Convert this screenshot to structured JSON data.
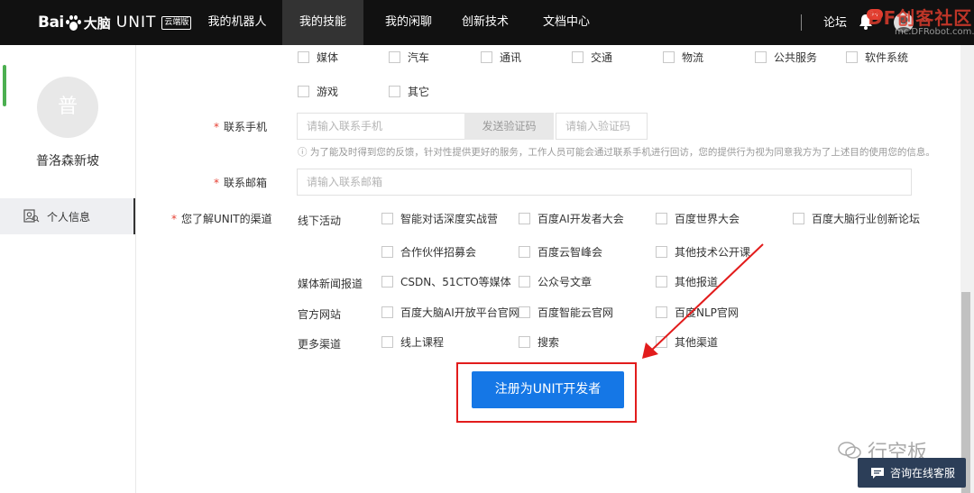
{
  "nav": {
    "logo_bai": "Bai",
    "logo_du": "大脑",
    "logo_unit": "UNIT",
    "logo_edition": "云端版",
    "items": [
      {
        "label": "我的机器人",
        "active": false
      },
      {
        "label": "我的技能",
        "active": true
      },
      {
        "label": "我的闲聊",
        "active": false
      },
      {
        "label": "创新技术",
        "active": false
      },
      {
        "label": "文档中心",
        "active": false
      }
    ],
    "forum": "论坛",
    "notification_badge": "9+"
  },
  "watermark_top": {
    "text": "DF创客社区",
    "sub": "mc.DFRobot.com.cn"
  },
  "sidebar": {
    "avatar_text": "普",
    "username": "普洛森新坡",
    "menu_item": "个人信息"
  },
  "industry_options_row1": [
    "媒体",
    "汽车",
    "通讯",
    "交通",
    "物流",
    "公共服务",
    "软件系统"
  ],
  "industry_options_row2": [
    "游戏",
    "其它"
  ],
  "phone": {
    "label": "联系手机",
    "placeholder": "请输入联系手机",
    "send_code": "发送验证码",
    "code_placeholder": "请输入验证码",
    "hint": "ⓘ 为了能及时得到您的反馈，针对性提供更好的服务，工作人员可能会通过联系手机进行回访，您的提供行为视为同意我方为了上述目的使用您的信息。"
  },
  "email": {
    "label": "联系邮箱",
    "placeholder": "请输入联系邮箱"
  },
  "channel": {
    "label": "您了解UNIT的渠道",
    "groups": [
      {
        "name": "线下活动",
        "options": [
          "智能对话深度实战营",
          "百度AI开发者大会",
          "百度世界大会",
          "百度大脑行业创新论坛",
          "合作伙伴招募会",
          "百度云智峰会",
          "其他技术公开课"
        ]
      },
      {
        "name": "媒体新闻报道",
        "options": [
          "CSDN、51CTO等媒体",
          "公众号文章",
          "其他报道"
        ]
      },
      {
        "name": "官方网站",
        "options": [
          "百度大脑AI开放平台官网",
          "百度智能云官网",
          "百度NLP官网"
        ]
      },
      {
        "name": "更多渠道",
        "options": [
          "线上课程",
          "搜索",
          "其他渠道"
        ]
      }
    ]
  },
  "submit_label": "注册为UNIT开发者",
  "watermark_bottom": "行空板",
  "chat_label": "咨询在线客服",
  "colors": {
    "primary": "#1577e6",
    "highlight": "#e21c1c",
    "nav_bg": "#111111"
  }
}
